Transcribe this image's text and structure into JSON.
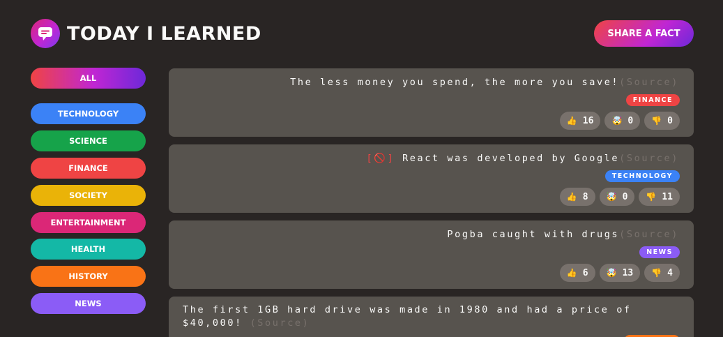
{
  "header": {
    "title": "TODAY I LEARNED",
    "logo_icon": "chat-bubble-icon",
    "share_label": "SHARE A FACT"
  },
  "sidebar": {
    "categories": [
      {
        "label": "ALL",
        "color": "gradient"
      },
      {
        "label": "TECHNOLOGY",
        "color": "#3b82f6"
      },
      {
        "label": "SCIENCE",
        "color": "#16a34a"
      },
      {
        "label": "FINANCE",
        "color": "#ef4444"
      },
      {
        "label": "SOCIETY",
        "color": "#eab308"
      },
      {
        "label": "ENTERTAINMENT",
        "color": "#db2777"
      },
      {
        "label": "HEALTH",
        "color": "#14b8a6"
      },
      {
        "label": "HISTORY",
        "color": "#f97316"
      },
      {
        "label": "NEWS",
        "color": "#8b5cf6"
      }
    ]
  },
  "facts": [
    {
      "text": "The less money you spend, the more you save!",
      "disputed_label": "",
      "source_label": "(Source)",
      "category": "FINANCE",
      "category_color": "#ef4444",
      "votes": {
        "interesting": "16",
        "mindblowing": "0",
        "false": "0"
      }
    },
    {
      "text": "React was developed by Google",
      "disputed_label": "[🚫]",
      "source_label": "(Source)",
      "category": "TECHNOLOGY",
      "category_color": "#3b82f6",
      "votes": {
        "interesting": "8",
        "mindblowing": "0",
        "false": "11"
      }
    },
    {
      "text": "Pogba caught with drugs",
      "disputed_label": "",
      "source_label": "(Source)",
      "category": "NEWS",
      "category_color": "#8b5cf6",
      "votes": {
        "interesting": "6",
        "mindblowing": "13",
        "false": "4"
      }
    },
    {
      "text": "The first 1GB hard drive was made in 1980 and had a price of $40,000!",
      "source_label": "(Source)",
      "category_color": "#f97316"
    }
  ],
  "vote_icons": {
    "interesting": "👍",
    "mindblowing": "🤯",
    "false": "👎"
  }
}
